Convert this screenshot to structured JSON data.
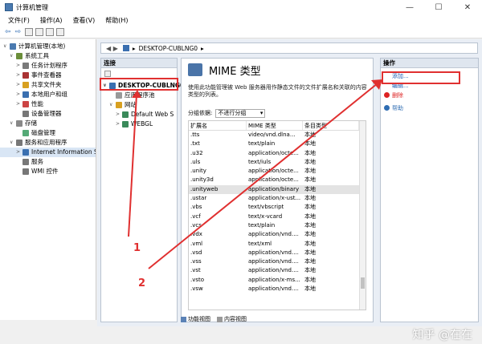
{
  "window": {
    "title": "计算机管理",
    "controls": [
      "—",
      "☐",
      "✕"
    ]
  },
  "menu": [
    "文件(F)",
    "操作(A)",
    "查看(V)",
    "帮助(H)"
  ],
  "tree": [
    {
      "label": "计算机管理(本地)",
      "indent": 0,
      "arrow": "∨",
      "color": "#4a7ab0"
    },
    {
      "label": "系统工具",
      "indent": 1,
      "arrow": "∨",
      "color": "#6b8e3a"
    },
    {
      "label": "任务计划程序",
      "indent": 2,
      "arrow": ">",
      "color": "#7a7a7a"
    },
    {
      "label": "事件查看器",
      "indent": 2,
      "arrow": ">",
      "color": "#a33"
    },
    {
      "label": "共享文件夹",
      "indent": 2,
      "arrow": ">",
      "color": "#d8a020"
    },
    {
      "label": "本地用户和组",
      "indent": 2,
      "arrow": ">",
      "color": "#3a6fb0"
    },
    {
      "label": "性能",
      "indent": 2,
      "arrow": ">",
      "color": "#c44"
    },
    {
      "label": "设备管理器",
      "indent": 2,
      "arrow": "",
      "color": "#777"
    },
    {
      "label": "存储",
      "indent": 1,
      "arrow": "∨",
      "color": "#888"
    },
    {
      "label": "磁盘管理",
      "indent": 2,
      "arrow": "",
      "color": "#5a7"
    },
    {
      "label": "服务和应用程序",
      "indent": 1,
      "arrow": "∨",
      "color": "#777"
    },
    {
      "label": "Internet Information S",
      "indent": 2,
      "arrow": ">",
      "color": "#3a6fb0",
      "selected": true
    },
    {
      "label": "服务",
      "indent": 2,
      "arrow": "",
      "color": "#777"
    },
    {
      "label": "WMI 控件",
      "indent": 2,
      "arrow": "",
      "color": "#777"
    }
  ],
  "address": {
    "path": "DESKTOP-CUBLNG0",
    "sep": "▸"
  },
  "connections": {
    "header": "连接",
    "items": [
      {
        "label": "DESKTOP-CUBLNG0",
        "indent": 0,
        "arrow": "∨",
        "color": "#3a6fb0"
      },
      {
        "label": "应用程序池",
        "indent": 1,
        "arrow": "",
        "color": "#999"
      },
      {
        "label": "网站",
        "indent": 1,
        "arrow": "∨",
        "color": "#d8a020"
      },
      {
        "label": "Default Web S",
        "indent": 2,
        "arrow": ">",
        "color": "#3a8a5a"
      },
      {
        "label": "WEBGL",
        "indent": 2,
        "arrow": ">",
        "color": "#3a8a5a"
      }
    ]
  },
  "main": {
    "title": "MIME 类型",
    "description": "使用此功能管理被 Web 服务器用作静态文件的文件扩展名和关联的内容类型的列表。",
    "group_label": "分组依据:",
    "group_value": "不进行分组",
    "columns": [
      "扩展名",
      "MIME 类型",
      "条目类型"
    ],
    "rows": [
      [
        ".tts",
        "video/vnd.dlna...",
        "本地"
      ],
      [
        ".txt",
        "text/plain",
        "本地"
      ],
      [
        ".u32",
        "application/octe...",
        "本地"
      ],
      [
        ".uls",
        "text/iuls",
        "本地"
      ],
      [
        ".unity",
        "application/octe...",
        "本地"
      ],
      [
        ".unity3d",
        "application/octe...",
        "本地"
      ],
      [
        ".unityweb",
        "application/binary",
        "本地"
      ],
      [
        ".ustar",
        "application/x-ust...",
        "本地"
      ],
      [
        ".vbs",
        "text/vbscript",
        "本地"
      ],
      [
        ".vcf",
        "text/x-vcard",
        "本地"
      ],
      [
        ".vcs",
        "text/plain",
        "本地"
      ],
      [
        ".vdx",
        "application/vnd....",
        "本地"
      ],
      [
        ".vml",
        "text/xml",
        "本地"
      ],
      [
        ".vsd",
        "application/vnd....",
        "本地"
      ],
      [
        ".vss",
        "application/vnd....",
        "本地"
      ],
      [
        ".vst",
        "application/vnd....",
        "本地"
      ],
      [
        ".vsto",
        "application/x-ms...",
        "本地"
      ],
      [
        ".vsw",
        "application/vnd....",
        "本地"
      ]
    ],
    "selected_row": 6,
    "tabs": [
      "功能视图",
      "内容视图"
    ]
  },
  "actions": {
    "header": "操作",
    "items": [
      {
        "label": "添加...",
        "color": "#1c5cb3"
      },
      {
        "label": "编辑...",
        "color": "#1c5cb3"
      },
      {
        "label": "删除",
        "color": "#d22"
      },
      {
        "label": "帮助",
        "color": "#2f6db3"
      }
    ]
  },
  "annotations": {
    "label1": "1",
    "label2": "2",
    "color": "#e03030"
  },
  "watermark": "知乎 @在在"
}
